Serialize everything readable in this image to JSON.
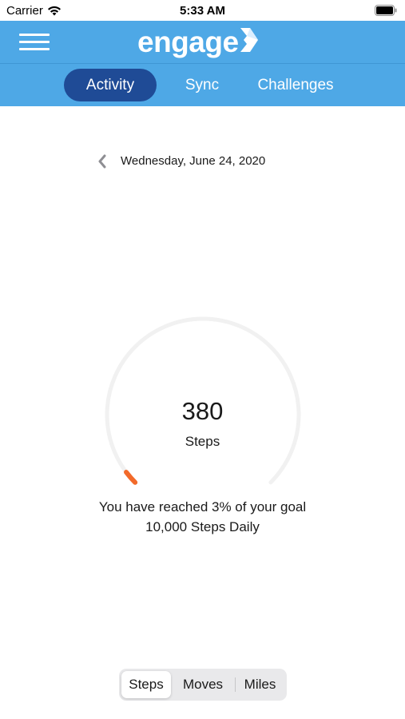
{
  "status_bar": {
    "carrier": "Carrier",
    "time": "5:33 AM"
  },
  "header": {
    "logo_text": "engage",
    "menu_icon": "hamburger-menu-icon",
    "brand_color": "#4ea8e6"
  },
  "tabs": [
    {
      "label": "Activity",
      "active": true
    },
    {
      "label": "Sync",
      "active": false
    },
    {
      "label": "Challenges",
      "active": false
    }
  ],
  "date_nav": {
    "back_icon": "chevron-left-icon",
    "date": "Wednesday, June 24, 2020"
  },
  "activity": {
    "value": "380",
    "unit": "Steps",
    "progress_fraction": 0.03,
    "progress_color": "#f26a2a",
    "track_color": "#f1f1f1"
  },
  "goal": {
    "line1": "You have reached 3% of your goal",
    "line2": "10,000 Steps Daily"
  },
  "metric_selector": [
    {
      "label": "Steps",
      "selected": true
    },
    {
      "label": "Moves",
      "selected": false
    },
    {
      "label": "Miles",
      "selected": false
    }
  ]
}
